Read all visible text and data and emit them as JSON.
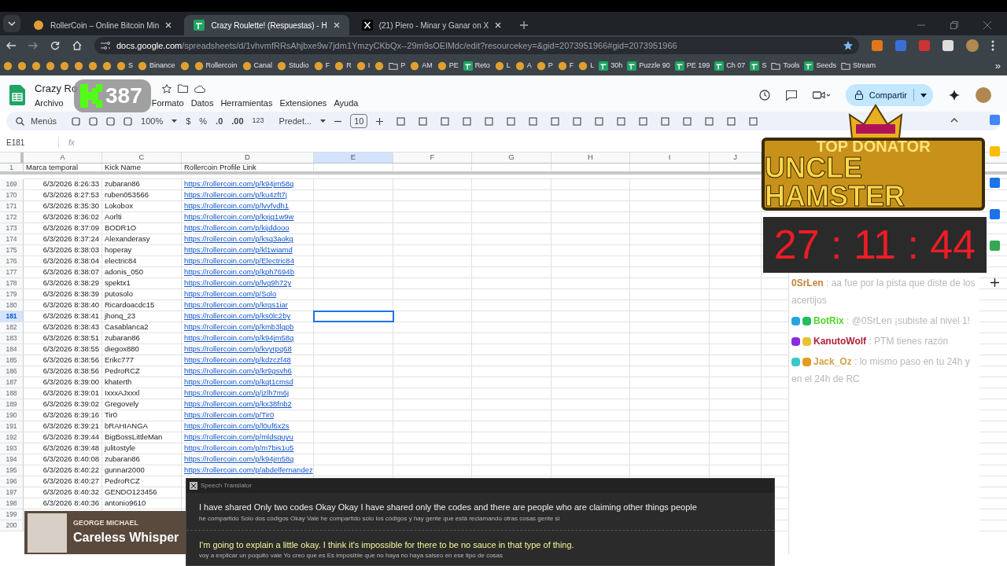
{
  "browser": {
    "tabs": [
      {
        "title": "RollerCoin – Online Bitcoin Min",
        "selected": false,
        "kind": "app"
      },
      {
        "title": "Crazy Roulette! (Respuestas) - H",
        "selected": true,
        "kind": "sheet"
      },
      {
        "title": "(21) Piero - Minar y Ganar on X",
        "selected": false,
        "kind": "x"
      }
    ],
    "address": {
      "host": "docs.google.com",
      "path": "/spreadsheets/d/1vhvmfRRsAhjbxe9w7jdm1YmzyCKbQx--29m9sOElMdc/edit?resourcekey=&gid=2073951966#gid=2073951966"
    },
    "bookmarks": [
      {
        "kind": "app"
      },
      {
        "kind": "app"
      },
      {
        "kind": "app"
      },
      {
        "kind": "app"
      },
      {
        "kind": "app"
      },
      {
        "kind": "app"
      },
      {
        "kind": "app"
      },
      {
        "kind": "app"
      },
      {
        "label": "S",
        "kind": "app"
      },
      {
        "label": "Binance",
        "kind": "app"
      },
      {
        "kind": "app"
      },
      {
        "label": "Rollercoin",
        "kind": "app"
      },
      {
        "label": "Canal",
        "kind": "app"
      },
      {
        "label": "Studio",
        "kind": "app"
      },
      {
        "label": "F",
        "kind": "app"
      },
      {
        "label": "R",
        "kind": "app"
      },
      {
        "label": "I",
        "kind": "app"
      },
      {
        "kind": "app"
      },
      {
        "label": "P",
        "kind": "folder"
      },
      {
        "label": "AM",
        "kind": "app"
      },
      {
        "label": "PE",
        "kind": "app"
      },
      {
        "label": "Reto",
        "kind": "sheet"
      },
      {
        "label": "L",
        "kind": "app"
      },
      {
        "label": "A",
        "kind": "app"
      },
      {
        "label": "P",
        "kind": "app"
      },
      {
        "label": "F",
        "kind": "app"
      },
      {
        "label": "L",
        "kind": "app"
      },
      {
        "label": "30h",
        "kind": "sheet"
      },
      {
        "label": "Puzzle 90",
        "kind": "sheet"
      },
      {
        "label": "PE 199",
        "kind": "sheet"
      },
      {
        "label": "Ch 07",
        "kind": "sheet"
      },
      {
        "label": "S",
        "kind": "sheet"
      },
      {
        "label": "Tools",
        "kind": "folder"
      },
      {
        "label": "Seeds",
        "kind": "sheet"
      },
      {
        "label": "Stream",
        "kind": "folder"
      }
    ],
    "more_bookmarks": "»"
  },
  "sheets": {
    "title": "Crazy Ro",
    "menu": [
      "Archivo",
      "Formato",
      "Datos",
      "Herramientas",
      "Extensiones",
      "Ayuda"
    ],
    "share_button": "Compartir",
    "toolbar": {
      "search": "Menús",
      "zoom": "100%",
      "currency": "$",
      "percent": "%",
      "decrease_decimals": ".0",
      "increase_decimals": ".00",
      "number_format": "123",
      "font": "Predet...",
      "font_size": "10"
    },
    "name_box": "E181",
    "formula_label": "fx",
    "columns": [
      {
        "letter": "A",
        "selected": false
      },
      {
        "letter": "C",
        "selected": false
      },
      {
        "letter": "D",
        "selected": false
      },
      {
        "letter": "E",
        "selected": true
      },
      {
        "letter": "F",
        "selected": false
      },
      {
        "letter": "G",
        "selected": false
      },
      {
        "letter": "H",
        "selected": false
      },
      {
        "letter": "I",
        "selected": false
      },
      {
        "letter": "J",
        "selected": false
      }
    ],
    "header_row": {
      "number": "1",
      "cells": [
        "Marca temporal",
        "Kick Name",
        "Rollercoin Profile Link"
      ]
    },
    "rows": [
      {
        "number": "169",
        "time": "6/3/2026 8:26:33",
        "name": "zubaran86",
        "link": "https://rollercoin.com/p/k94jm58q",
        "selected": false
      },
      {
        "number": "170",
        "time": "6/3/2026 8:27:53",
        "name": "ruben053566",
        "link": "https://rollercoin.com/p/ku4zft7j",
        "selected": false
      },
      {
        "number": "171",
        "time": "6/3/2026 8:35:30",
        "name": "Lokobox",
        "link": "https://rollercoin.com/p/lvvfvdh1",
        "selected": false
      },
      {
        "number": "172",
        "time": "6/3/2026 8:36:02",
        "name": "Aorlti",
        "link": "https://rollercoin.com/p/kxjg1w9w",
        "selected": false
      },
      {
        "number": "173",
        "time": "6/3/2026 8:37:09",
        "name": "BODR1O",
        "link": "https://rollercoin.com/p/kijddooo",
        "selected": false
      },
      {
        "number": "174",
        "time": "6/3/2026 8:37:24",
        "name": "Alexanderasy",
        "link": "https://rollercoin.com/p/ksq3aokg",
        "selected": false
      },
      {
        "number": "175",
        "time": "6/3/2026 8:38:03",
        "name": "hoperay",
        "link": "https://rollercoin.com/p/kl1wiamd",
        "selected": false
      },
      {
        "number": "176",
        "time": "6/3/2026 8:38:04",
        "name": "electric84",
        "link": "https://rollercoin.com/p/Electric84",
        "selected": false
      },
      {
        "number": "177",
        "time": "6/3/2026 8:38:07",
        "name": "adonis_050",
        "link": "https://rollercoin.com/p/kph7694b",
        "selected": false
      },
      {
        "number": "178",
        "time": "6/3/2026 8:38:29",
        "name": "spektx1",
        "link": "https://rollercoin.com/p/lvg9h72y",
        "selected": false
      },
      {
        "number": "179",
        "time": "6/3/2026 8:38:39",
        "name": "putosolo",
        "link": "https://rollercoin.com/p/Solo",
        "selected": false
      },
      {
        "number": "180",
        "time": "6/3/2026 8:38:40",
        "name": "Ricardoacdc15",
        "link": "https://rollercoin.com/p/krgs1iar",
        "selected": false
      },
      {
        "number": "181",
        "time": "6/3/2026 8:38:41",
        "name": "jhonq_23",
        "link": "https://rollercoin.com/p/ks0lc2by",
        "selected": true
      },
      {
        "number": "182",
        "time": "6/3/2026 8:38:43",
        "name": "Casablanca2",
        "link": "https://rollercoin.com/p/kmb3lqpb",
        "selected": false
      },
      {
        "number": "183",
        "time": "6/3/2026 8:38:51",
        "name": "zubaran86",
        "link": "https://rollercoin.com/p/k94jm58q",
        "selected": false
      },
      {
        "number": "184",
        "time": "6/3/2026 8:38:55",
        "name": "diegox880",
        "link": "https://rollercoin.com/p/kvyrpq68",
        "selected": false
      },
      {
        "number": "185",
        "time": "6/3/2026 8:38:56",
        "name": "Erikc777",
        "link": "https://rollercoin.com/p/kdzczf48",
        "selected": false
      },
      {
        "number": "186",
        "time": "6/3/2026 8:38:56",
        "name": "PedroRCZ",
        "link": "https://rollercoin.com/p/kr9gsvh6",
        "selected": false
      },
      {
        "number": "187",
        "time": "6/3/2026 8:39:00",
        "name": "khaterth",
        "link": "https://rollercoin.com/p/kqt1cmsd",
        "selected": false
      },
      {
        "number": "188",
        "time": "6/3/2026 8:39:01",
        "name": "IxxxAJxxxl",
        "link": "https://rollercoin.com/p/jzlh7m6j",
        "selected": false
      },
      {
        "number": "189",
        "time": "6/3/2026 8:39:02",
        "name": "Gregovely",
        "link": "https://rollercoin.com/p/kx38fnb2",
        "selected": false
      },
      {
        "number": "190",
        "time": "6/3/2026 8:39:16",
        "name": "Tir0",
        "link": "https://rollercoin.com/p/Tir0",
        "selected": false
      },
      {
        "number": "191",
        "time": "6/3/2026 8:39:21",
        "name": "bRAHIANGA",
        "link": "https://rollercoin.com/p/l0uf6x2s",
        "selected": false
      },
      {
        "number": "192",
        "time": "6/3/2026 8:39:44",
        "name": "BigBossLittleMan",
        "link": "https://rollercoin.com/p/mldsguyu",
        "selected": false
      },
      {
        "number": "193",
        "time": "6/3/2026 8:39:48",
        "name": "julitostyle",
        "link": "https://rollercoin.com/p/m7bis1u5",
        "selected": false
      },
      {
        "number": "194",
        "time": "6/3/2026 8:40:08",
        "name": "zubaran86",
        "link": "https://rollercoin.com/p/k94jm58q",
        "selected": false
      },
      {
        "number": "195",
        "time": "6/3/2026 8:40:22",
        "name": "gunnar2000",
        "link": "https://rollercoin.com/p/abdelfernandez",
        "selected": false
      },
      {
        "number": "196",
        "time": "6/3/2026 8:40:27",
        "name": "PedroRCZ",
        "selected": false
      },
      {
        "number": "197",
        "time": "6/3/2026 8:40:32",
        "name": "GENDO123456",
        "selected": false
      },
      {
        "number": "198",
        "time": "6/3/2026 8:40:36",
        "name": "antonio9610",
        "selected": false
      },
      {
        "number": "199",
        "selected": false
      },
      {
        "number": "200",
        "selected": false
      }
    ]
  },
  "overlays": {
    "view_counter": "387",
    "donator_banner": {
      "heading": "TOP DONATOR",
      "name": "UNCLE HAMSTER"
    },
    "timer": "27 : 11 : 44",
    "chat": [
      {
        "user": "0SrLen",
        "text": ": aa fue por la pista que diste de los acertijos",
        "color": "#c8813a"
      },
      {
        "user": "BotRix",
        "text": ": @0SrLen ¡subiste al nivel 1!",
        "color": "#53d62b",
        "badges": [
          {
            "color": "#2ba3dc"
          },
          {
            "color": "#1fbf5c"
          }
        ]
      },
      {
        "user": "KanutoWolf",
        "text": ": PTM tienes razón",
        "color": "#b0203a",
        "badges": [
          {
            "color": "#8a2be2"
          },
          {
            "color": "#e8c232"
          }
        ]
      },
      {
        "user": "Jack_Oz",
        "text": ": lo mismo paso en tu 24h y en el 24h de RC",
        "color": "#d1a24a",
        "badges": [
          {
            "color": "#3cc8c8"
          },
          {
            "color": "#e89a20"
          }
        ]
      }
    ],
    "now_playing": {
      "artist": "GEORGE MICHAEL",
      "song": "Careless Whisper"
    },
    "translator": {
      "title": "Speech Translator",
      "entries": [
        {
          "original": "I have shared Only two codes Okay Okay I have shared only the codes and there are people who are claiming other things people",
          "translation": "he compartido Solo dos códigos Okay Vale he compartido solo los códigos y hay gente que está reclamando otras cosas gente si",
          "latest": false
        },
        {
          "original": "I'm going to explain a little okay. I think it's impossible for there to be no sauce in that type of thing.",
          "translation": "voy a explicar un poquito vale Yo creo que es Es imposible que no haya no haya salseo en ese tipo de cosas",
          "latest": true
        }
      ]
    }
  }
}
